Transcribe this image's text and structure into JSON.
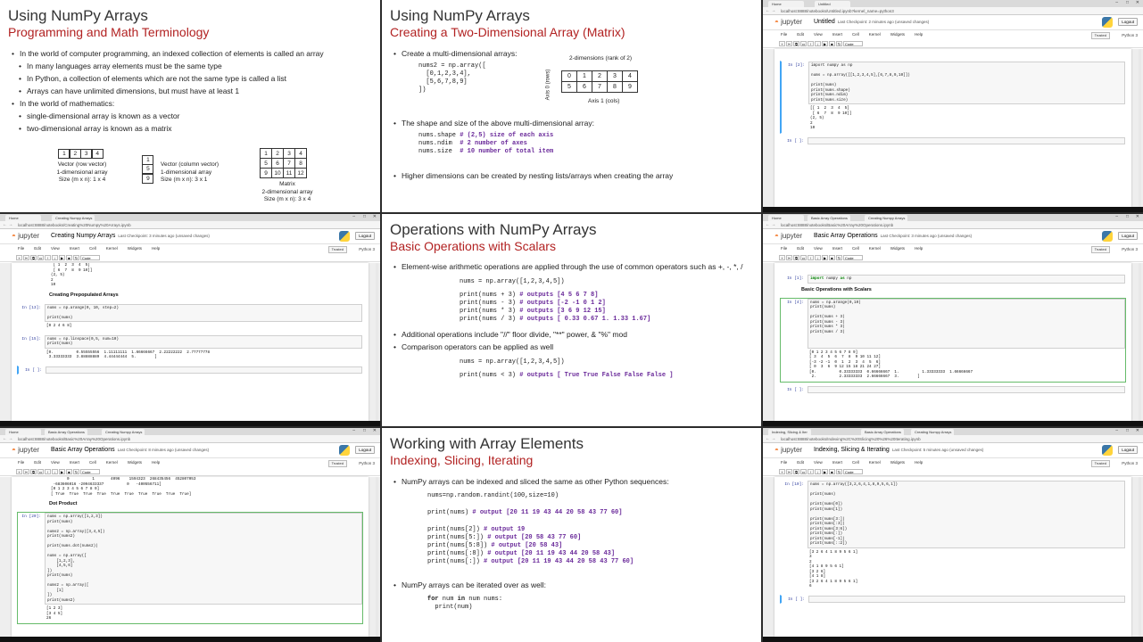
{
  "slide1": {
    "title": "Using NumPy Arrays",
    "subtitle": "Programming and Math Terminology",
    "bullets": [
      "In the world of computer programming, an indexed collection of elements is called an array",
      "In many languages array elements must be the same type",
      "In Python, a collection of elements which are not the same type is called a list",
      "Arrays can have unlimited dimensions, but must have at least 1",
      "In the world of mathematics:",
      "single-dimensional array is known as a vector",
      "two-dimensional array is known as a matrix"
    ],
    "row_vector": [
      "1",
      "2",
      "3",
      "4"
    ],
    "row_caption": [
      "Vector (row vector)",
      "1-dimensional array",
      "Size (m x n): 1 x 4"
    ],
    "col_vector": [
      "1",
      "5",
      "9"
    ],
    "col_caption": [
      "Vector (column vector)",
      "1-dimensional array",
      "Size (m x n): 3 x 1"
    ],
    "matrix": [
      [
        "1",
        "2",
        "3",
        "4"
      ],
      [
        "5",
        "6",
        "7",
        "8"
      ],
      [
        "9",
        "10",
        "11",
        "12"
      ]
    ],
    "matrix_caption": [
      "Matrix",
      "2-dimensional array",
      "Size (m x n): 3 x 4"
    ]
  },
  "slide2": {
    "title": "Using NumPy Arrays",
    "subtitle": "Creating a Two-Dimensional Array (Matrix)",
    "bullet1": "Create a multi-dimensional arrays:",
    "code1": "nums2 = np.array([\n  [0,1,2,3,4],\n  [5,6,7,8,9]\n])",
    "dims_label": "2-dimensions (rank of 2)",
    "axis0": "Axis 0 (rows)",
    "axis1": "Axis 1 (cols)",
    "matrix": [
      [
        "0",
        "1",
        "2",
        "3",
        "4"
      ],
      [
        "5",
        "6",
        "7",
        "8",
        "9"
      ]
    ],
    "bullet2": "The shape and size of the above multi-dimensional array:",
    "shape_code": [
      {
        "c": "nums.shape ",
        "k": "# (2,5) size of each axis"
      },
      {
        "c": "nums.ndim  ",
        "k": "# 2 number of axes"
      },
      {
        "c": "nums.size  ",
        "k": "# 10 number of total item"
      }
    ],
    "bullet3": "Higher dimensions can be created by nesting lists/arrays when creating the array"
  },
  "nb1": {
    "tabs": [
      "Home",
      "Untitled"
    ],
    "url": "localhost:8888/notebooks/Untitled.ipynb?kernel_name=python3",
    "name": "Untitled",
    "checkpoint": "Last Checkpoint: 2 minutes ago (unsaved changes)",
    "kernel": "Python 3",
    "cells": [
      {
        "prompt": "In [2]:",
        "code": "import numpy as np\n\nnums = np.array([[1,2,3,4,5],[6,7,8,9,10]])\n\nprint(nums)\nprint(nums.shape)\nprint(nums.ndim)\nprint(nums.size)",
        "out": "[[ 1  2  3  4  5]\n [ 6  7  8  9 10]]\n(2, 5)\n2\n10"
      },
      {
        "prompt": "In [ ]:",
        "code": "",
        "out": ""
      }
    ]
  },
  "nb2": {
    "tabs": [
      "Home",
      "Creating Numpy Arrays"
    ],
    "url": "localhost:8888/notebooks/Creating%20Numpy%20Arrays.ipynb",
    "name": "Creating Numpy Arrays",
    "checkpoint": "Last Checkpoint: 3 minutes ago (unsaved changes)",
    "kernel": "Python 3",
    "top_out": " [ 1  2  3  4  5]\n [ 6  7  8  9 10]]\n(2, 5)\n2\n10",
    "heading": "Creating Prepopulated Arrays",
    "cells": [
      {
        "prompt": "In [13]:",
        "code": "nums = np.arange(0, 10, step=2)\n\nprint(nums)",
        "out": "[0 2 4 6 8]"
      },
      {
        "prompt": "In [15]:",
        "code": "nums = np.linspace(0,5, num=10)\nprint(nums)",
        "out": "[0.          0.55555556  1.11111111  1.66666667  2.22222222  2.77777778\n 3.33333333  3.88888889  4.44444444  5.        ]"
      },
      {
        "prompt": "In [ ]:",
        "code": "",
        "out": ""
      }
    ]
  },
  "nb3": {
    "tabs": [
      "Home",
      "Basic Array Operations",
      "Creating Numpy Arrays"
    ],
    "url": "localhost:8888/notebooks/Basic%20Array%20Operations.ipynb",
    "name": "Basic Array Operations",
    "checkpoint": "Last Checkpoint: 3 minutes ago (unsaved changes)",
    "kernel": "Python 3",
    "heading": "Basic Operations with Scalars",
    "cells": [
      {
        "prompt": "In [1]:",
        "code": "import numpy as np",
        "out": ""
      },
      {
        "prompt": "In [4]:",
        "code": "nums = np.arange(0,10)\nprint(nums)\n\nprint(nums + 3)\nprint(nums - 3)\nprint(nums * 3)\nprint(nums / 3)\n\n",
        "out": "[0 1 2 3 4 5 6 7 8 9]\n[ 3  4  5  6  7  8  9 10 11 12]\n[-3 -2 -1  0  1  2  3  4  5  6]\n[ 0  3  6  9 12 15 18 21 24 27]\n[0.          0.33333333  0.66666667  1.          1.33333333  1.66666667\n 2.          2.33333333  2.66666667  3.        ]"
      },
      {
        "prompt": "In [ ]:",
        "code": "",
        "out": ""
      }
    ]
  },
  "slide5": {
    "title": "Operations with NumPy Arrays",
    "subtitle": "Basic Operations with Scalars",
    "bullet1": "Element-wise arithmetic operations are applied through the use of common operators such as +, -, *, /",
    "code_decl": "nums = np.array([1,2,3,4,5])",
    "ops": [
      {
        "c": "print(nums + 3) ",
        "k": "# outputs [4 5 6 7 8]"
      },
      {
        "c": "print(nums - 3) ",
        "k": "# outputs [-2 -1 0 1 2]"
      },
      {
        "c": "print(nums * 3) ",
        "k": "# outputs [3 6 9 12 15]"
      },
      {
        "c": "print(nums / 3) ",
        "k": "# outputs [ 0.33 0.67 1. 1.33 1.67]"
      }
    ],
    "bullet2": "Additional operations include \"//\" floor divide, \"**\" power, & \"%\" mod",
    "bullet3": "Comparison operators can be applied as well",
    "code_decl2": "nums = np.array([1,2,3,4,5])",
    "cmp": {
      "c": "print(nums < 3) ",
      "k": "# outputs [ True True False False False ]"
    }
  },
  "nb5": {
    "tabs": [
      "Home",
      "Basic Array Operations",
      "Creating Numpy Arrays"
    ],
    "url": "localhost:8888/notebooks/Basic%20Array%20Operations.ipynb",
    "name": "Basic Array Operations",
    "checkpoint": "Last Checkpoint: 8 minutes ago (unsaved changes)",
    "kernel": "Python 3",
    "top_out": "       0          1       4096    1594323  268435456  452807053\n -683606016 -2094633337          0   -400556711]\n[0 1 2 3 4 5 6 7 8 9]\n[ True  True  True  True  True  True  True  True  True  True]",
    "heading": "Dot Product",
    "cells": [
      {
        "prompt": "In [20]:",
        "code": "nums = np.array([1,2,3])\nprint(nums)\n\nnums2 = np.array([3,4,5])\nprint(nums2)\n\nprint(nums.dot(nums2))\n\nnums = np.array([\n    [1,2,3],\n    [4,5,6]\n])\nprint(nums)\n\nnums2 = np.array([\n    [1]\n])\nprint(nums2)",
        "out": "[1 2 3]\n[3 4 5]\n26"
      }
    ]
  },
  "slide8": {
    "title": "Working with Array Elements",
    "subtitle": "Indexing, Slicing, Iterating",
    "bullet1": "NumPy arrays can be indexed and sliced the same as other Python sequences:",
    "decl": "nums=np.random.randint(100,size=10)",
    "print_all": {
      "c": "print(nums) ",
      "k": "# output [20 11 19 43 44 20 58 43 77 60]"
    },
    "slices": [
      {
        "c": "print(nums[2]) ",
        "k": "# output 19"
      },
      {
        "c": "print(nums[5:]) ",
        "k": "# output [20 58 43 77 60]"
      },
      {
        "c": "print(nums[5:8]) ",
        "k": "# output [20 58 43]"
      },
      {
        "c": "print(nums[:8]) ",
        "k": "# output [20 11 19 43 44 20 58 43]"
      },
      {
        "c": "print(nums[:]) ",
        "k": "# output [20 11 19 43 44 20 58 43 77 60]"
      }
    ],
    "bullet2": "NumPy arrays can be iterated over as well:",
    "loop1": "num nums:",
    "loop2": "  print(num)",
    "kw_for": "for",
    "kw_in": "in"
  },
  "nb9": {
    "tabs": [
      "Indexing, Slicing & Iter",
      "Basic Array Operations",
      "Creating Numpy Arrays"
    ],
    "url": "localhost:8888/notebooks/Indexing%2C%20Slicing%20%26%20Iterating.ipynb",
    "name": "Indexing, Slicing & Iterating",
    "checkpoint": "Last Checkpoint: 5 minutes ago (unsaved changes)",
    "kernel": "Python 3",
    "cells": [
      {
        "prompt": "In [10]:",
        "code": "nums = np.array([3,2,6,4,1,8,9,5,6,1])\n\nprint(nums)\n\nprint(nums[0])\nprint(nums[1])\n\nprint(nums[3:])\nprint(nums[:3])\nprint(nums[3:6])\nprint(nums[:])\nprint(nums[-1])\nprint(nums[::2])",
        "out": "[3 2 6 4 1 8 9 5 6 1]\n3\n2\n[4 1 8 9 5 6 1]\n[3 2 6]\n[4 1 8]\n[3 2 6 4 1 8 9 5 6 1]\n6"
      },
      {
        "prompt": "In [ ]:",
        "code": "",
        "out": ""
      }
    ]
  },
  "jupyter": {
    "logo": "jupyter",
    "logout": "Logout",
    "trusted": "Trusted",
    "menu": [
      "File",
      "Edit",
      "View",
      "Insert",
      "Cell",
      "Kernel",
      "Widgets",
      "Help"
    ],
    "celltype": "Code",
    "toolbar": [
      "+",
      "✂",
      "⧉",
      "▭",
      "↑",
      "↓",
      "▶",
      "■",
      "↻"
    ]
  }
}
